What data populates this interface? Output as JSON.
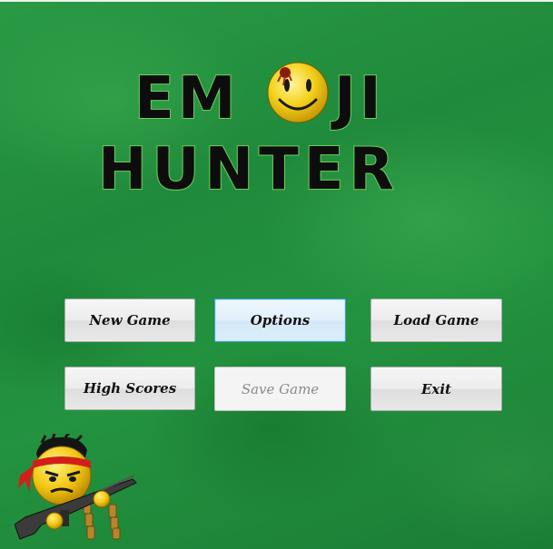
{
  "title": {
    "line1": "EMOJI",
    "line2": "HUNTER",
    "line1_before": "EM",
    "line1_after": "JI"
  },
  "menu": {
    "new_game": "New Game",
    "options": "Options",
    "load_game": "Load Game",
    "high_scores": "High Scores",
    "save_game": "Save Game",
    "exit": "Exit"
  },
  "state": {
    "focused_button": "Options",
    "disabled_buttons": [
      "Save Game"
    ]
  },
  "icons": {
    "title_o": "wounded-smiley-icon",
    "mascot": "commando-emoji-with-machine-gun"
  },
  "colors": {
    "background": "#1f8a3b",
    "title_fill": "#0d0d0d",
    "title_outline": "#6fcf5a",
    "button_face": "#ececec",
    "focus_border": "#3c9ee0",
    "smiley": "#f4d21c"
  }
}
